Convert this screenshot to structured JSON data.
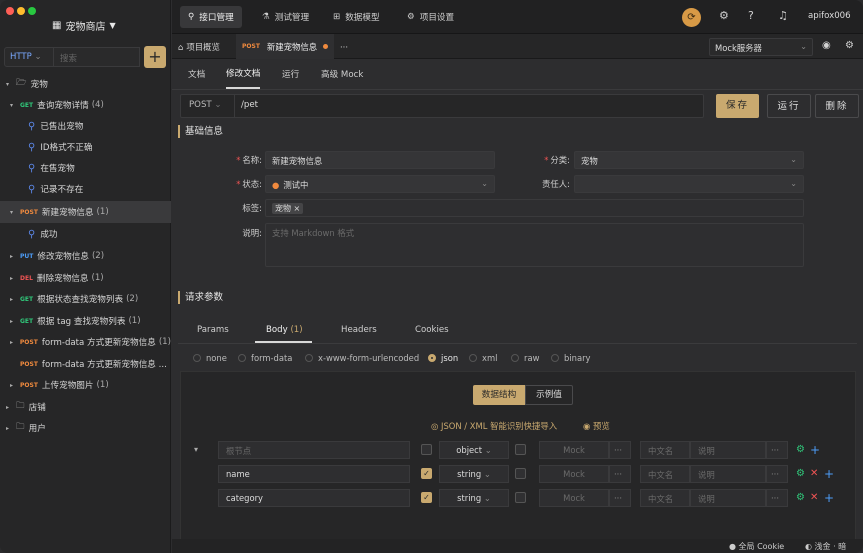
{
  "colors": {
    "accent": "#c9a96f",
    "get": "#30c77a",
    "post": "#f08a3e",
    "put": "#4d9df8",
    "del": "#f05454"
  },
  "sidebar": {
    "project": "宠物商店",
    "http": "HTTP",
    "search_placeholder": "搜索",
    "add": "+",
    "tree": [
      {
        "kind": "folder",
        "label": "宠物",
        "icon": "folder-open-icon",
        "arrow": "▾"
      },
      {
        "kind": "api",
        "method": "GET",
        "label": "查询宠物详情",
        "count": "(4)",
        "arrow": "▾"
      },
      {
        "kind": "example",
        "label": "已售出宠物"
      },
      {
        "kind": "example",
        "label": "ID格式不正确"
      },
      {
        "kind": "example",
        "label": "在售宠物"
      },
      {
        "kind": "example",
        "label": "记录不存在"
      },
      {
        "kind": "api",
        "method": "POST",
        "label": "新建宠物信息",
        "count": "(1)",
        "arrow": "▾",
        "selected": true
      },
      {
        "kind": "example",
        "label": "成功"
      },
      {
        "kind": "api",
        "method": "PUT",
        "label": "修改宠物信息",
        "count": "(2)",
        "arrow": "▸"
      },
      {
        "kind": "api",
        "method": "DEL",
        "label": "删除宠物信息",
        "count": "(1)",
        "arrow": "▸"
      },
      {
        "kind": "api",
        "method": "GET",
        "label": "根据状态查找宠物列表",
        "count": "(2)",
        "arrow": "▸"
      },
      {
        "kind": "api",
        "method": "GET",
        "label": "根据 tag 查找宠物列表",
        "count": "(1)",
        "arrow": "▸"
      },
      {
        "kind": "api",
        "method": "POST",
        "label": "form-data 方式更新宠物信息",
        "count": "(1)",
        "arrow": "▸"
      },
      {
        "kind": "api",
        "method": "POST",
        "label": "form-data 方式更新宠物信息 ...",
        "count": "",
        "arrow": ""
      },
      {
        "kind": "api",
        "method": "POST",
        "label": "上传宠物图片",
        "count": "(1)",
        "arrow": "▸"
      },
      {
        "kind": "folder",
        "label": "店铺",
        "icon": "folder-icon",
        "arrow": "▸"
      },
      {
        "kind": "folder",
        "label": "用户",
        "icon": "folder-icon",
        "arrow": "▸"
      }
    ]
  },
  "topnav": [
    {
      "label": "接口管理",
      "icon": "⚲"
    },
    {
      "label": "测试管理",
      "icon": "⚗"
    },
    {
      "label": "数据模型",
      "icon": "⊞"
    },
    {
      "label": "项目设置",
      "icon": "⚙"
    }
  ],
  "user": "apifox006",
  "tabs": {
    "overview": "项目概览",
    "active_method": "POST",
    "active": "新建宠物信息",
    "more": "···"
  },
  "mock_server": "Mock服务器",
  "subtabs": [
    "文档",
    "修改文档",
    "运行",
    "高级 Mock"
  ],
  "request": {
    "method": "POST",
    "url": "/pet",
    "save": "保存",
    "run": "运行",
    "delete": "删除"
  },
  "basic": {
    "title": "基础信息",
    "name_label": "名称:",
    "name_value": "新建宠物信息",
    "category_label": "分类:",
    "category_value": "宠物",
    "status_label": "状态:",
    "status_value": "测试中",
    "owner_label": "责任人:",
    "tags_label": "标签:",
    "tag_value": "宠物 ×",
    "desc_label": "说明:",
    "desc_placeholder": "支持 Markdown 格式"
  },
  "params": {
    "title": "请求参数",
    "tabs": [
      "Params",
      "Body",
      "Headers",
      "Cookies"
    ],
    "body_count": "(1)",
    "body_types": [
      "none",
      "form-data",
      "x-www-form-urlencoded",
      "json",
      "xml",
      "raw",
      "binary"
    ],
    "selected_type": "json",
    "seg_struct": "数据结构",
    "seg_example": "示例值",
    "import": "JSON / XML 智能识别快捷导入",
    "preview": "预览",
    "rows": [
      {
        "name": "",
        "name_ph": "根节点",
        "type": "object",
        "mock": "Mock",
        "cn": "中文名",
        "desc": "说明",
        "checked": false
      },
      {
        "name": "name",
        "name_ph": "",
        "type": "string",
        "mock": "Mock",
        "cn": "中文名",
        "desc": "说明",
        "checked": true
      },
      {
        "name": "category",
        "name_ph": "",
        "type": "string",
        "mock": "Mock",
        "cn": "中文名",
        "desc": "说明",
        "checked": true
      }
    ]
  },
  "status": {
    "cookie": "全局 Cookie",
    "theme": "浅金 · 暗"
  }
}
